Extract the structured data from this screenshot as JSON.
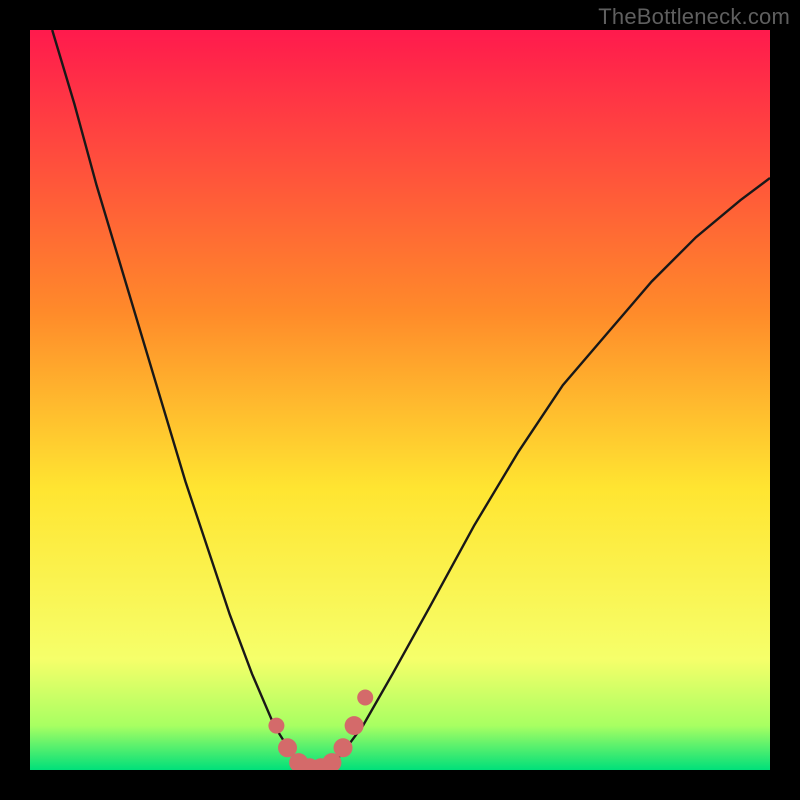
{
  "watermark": "TheBottleneck.com",
  "colors": {
    "frame": "#000000",
    "watermark": "#5f5f5f",
    "gradient_top": "#ff1a4d",
    "gradient_mid_upper": "#ff8a2a",
    "gradient_mid": "#ffe531",
    "gradient_lower": "#f6ff6a",
    "gradient_near_bottom": "#a8ff62",
    "gradient_bottom": "#00e07a",
    "curve": "#191818",
    "marker_fill": "#d46a6a",
    "marker_stroke": "#d46a6a"
  },
  "chart_data": {
    "type": "line",
    "title": "",
    "xlabel": "",
    "ylabel": "",
    "xlim": [
      0,
      1
    ],
    "ylim": [
      0,
      1
    ],
    "series": [
      {
        "name": "bottleneck-curve",
        "x": [
          0.03,
          0.06,
          0.09,
          0.12,
          0.15,
          0.18,
          0.21,
          0.24,
          0.27,
          0.3,
          0.33,
          0.355,
          0.38,
          0.4,
          0.42,
          0.45,
          0.49,
          0.54,
          0.6,
          0.66,
          0.72,
          0.78,
          0.84,
          0.9,
          0.96,
          1.0
        ],
        "y": [
          1.0,
          0.9,
          0.79,
          0.69,
          0.59,
          0.49,
          0.39,
          0.3,
          0.21,
          0.13,
          0.06,
          0.02,
          0.003,
          0.003,
          0.02,
          0.06,
          0.13,
          0.22,
          0.33,
          0.43,
          0.52,
          0.59,
          0.66,
          0.72,
          0.77,
          0.8
        ]
      }
    ],
    "markers": {
      "name": "low-bottleneck-band",
      "x": [
        0.333,
        0.348,
        0.363,
        0.378,
        0.393,
        0.408,
        0.423,
        0.438,
        0.453
      ],
      "y": [
        0.06,
        0.03,
        0.01,
        0.003,
        0.003,
        0.01,
        0.03,
        0.06,
        0.098
      ]
    }
  }
}
